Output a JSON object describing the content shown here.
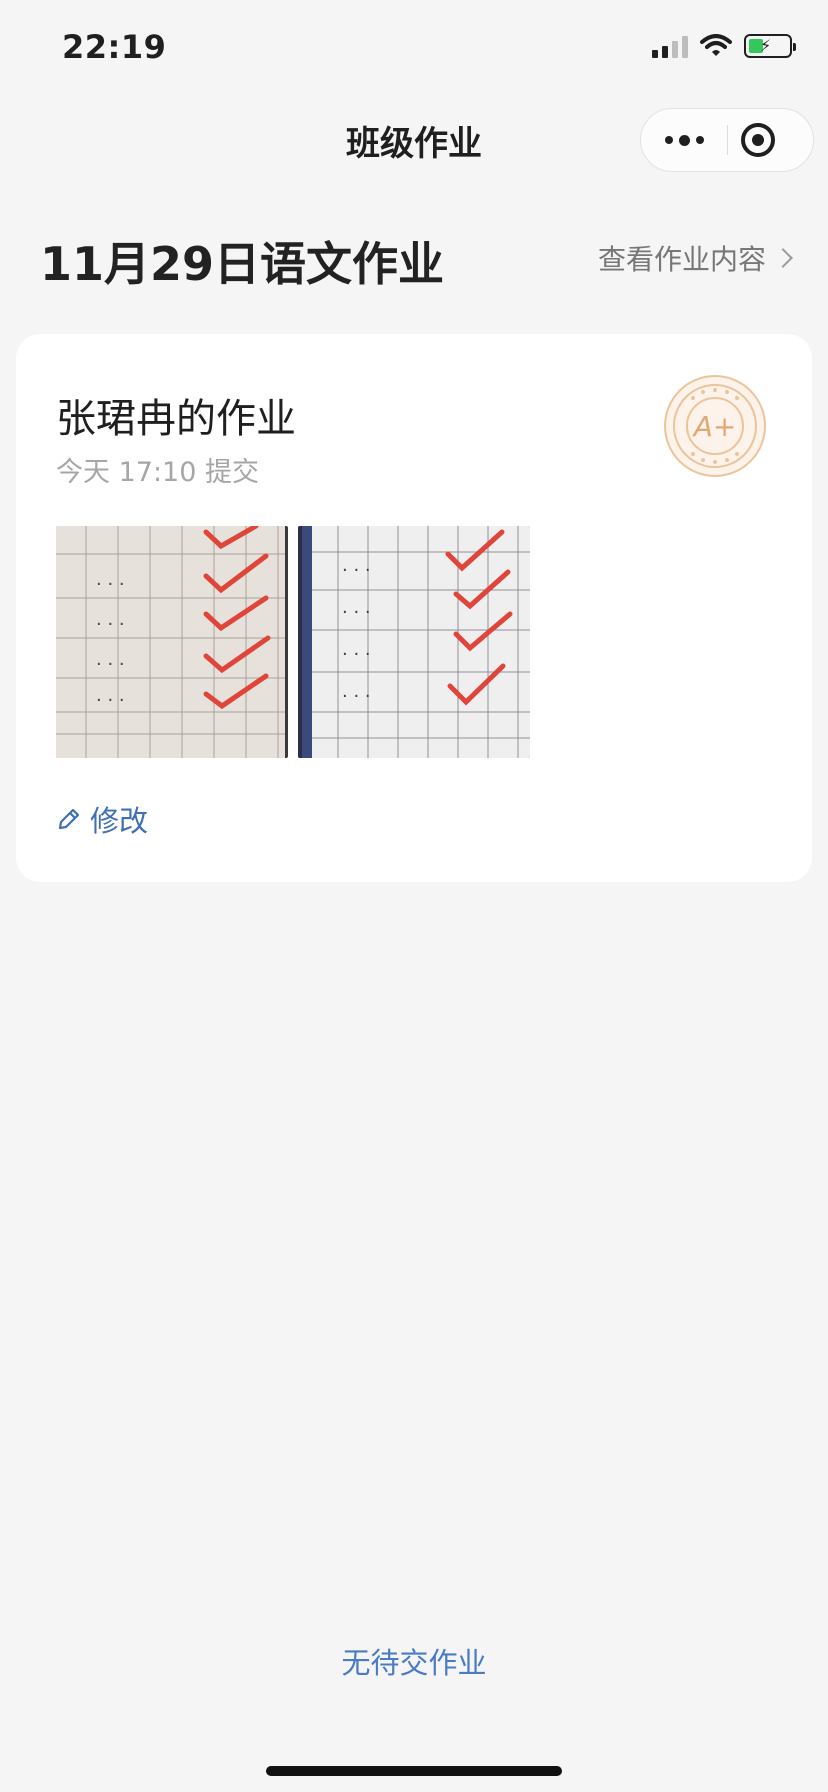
{
  "status_bar": {
    "time": "22:19"
  },
  "nav": {
    "title": "班级作业",
    "more_icon": "more-dots-icon",
    "close_icon": "target-close-icon"
  },
  "header": {
    "title": "11月29日语文作业",
    "view_link": "查看作业内容"
  },
  "card": {
    "title": "张珺冉的作业",
    "submit_time": "今天 17:10 提交",
    "grade_stamp": "A+",
    "photos": [
      "homework-photo-1",
      "homework-photo-2"
    ],
    "edit_label": "修改"
  },
  "footer": {
    "status": "无待交作业"
  },
  "colors": {
    "accent_blue": "#4a7bc4",
    "stamp_orange": "#e8b88c",
    "check_red": "#e0453a",
    "background": "#f5f5f5"
  }
}
